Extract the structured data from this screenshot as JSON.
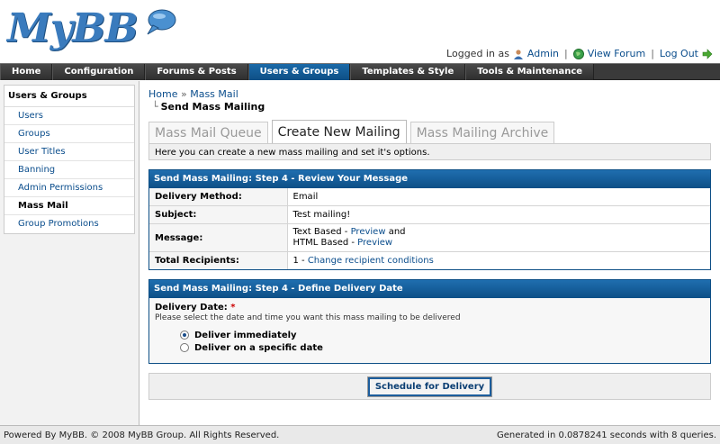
{
  "header": {
    "logo_text": "MyBB",
    "logged_in_as": "Logged in as",
    "admin_link": "Admin",
    "view_forum_link": "View Forum",
    "logout_link": "Log Out"
  },
  "nav": {
    "tabs": [
      "Home",
      "Configuration",
      "Forums & Posts",
      "Users & Groups",
      "Templates & Style",
      "Tools & Maintenance"
    ],
    "active": "Users & Groups"
  },
  "sidebar": {
    "title": "Users & Groups",
    "items": [
      "Users",
      "Groups",
      "User Titles",
      "Banning",
      "Admin Permissions",
      "Mass Mail",
      "Group Promotions"
    ],
    "current": "Mass Mail"
  },
  "breadcrumb": {
    "home": "Home",
    "sep": "»",
    "section": "Mass Mail",
    "current": "Send Mass Mailing"
  },
  "tabs": [
    "Mass Mail Queue",
    "Create New Mailing",
    "Mass Mailing Archive"
  ],
  "intro": "Here you can create a new mass mailing and set it's options.",
  "review": {
    "title": "Send Mass Mailing: Step 4 - Review Your Message",
    "delivery_method_label": "Delivery Method:",
    "delivery_method_value": "Email",
    "subject_label": "Subject:",
    "subject_value": "Test mailing!",
    "message_label": "Message:",
    "text_based": "Text Based - ",
    "html_based": "HTML Based - ",
    "preview": "Preview",
    "and": " and",
    "recipients_label": "Total Recipients:",
    "recipients_count": "1 - ",
    "change_recipients": "Change recipient conditions"
  },
  "delivery": {
    "title": "Send Mass Mailing: Step 4 - Define Delivery Date",
    "label": "Delivery Date:",
    "required": "*",
    "description": "Please select the date and time you want this mass mailing to be delivered",
    "option_immediately": "Deliver immediately",
    "option_specific": "Deliver on a specific date",
    "selected": "immediately"
  },
  "submit_label": "Schedule for Delivery",
  "footer": {
    "left": "Powered By MyBB. © 2008 MyBB Group. All Rights Reserved.",
    "right": "Generated in 0.0878241 seconds with 8 queries."
  },
  "colors": {
    "accent": "#0e4f86",
    "nav_bg": "#3a3a3a",
    "link": "#0a4d8c"
  }
}
